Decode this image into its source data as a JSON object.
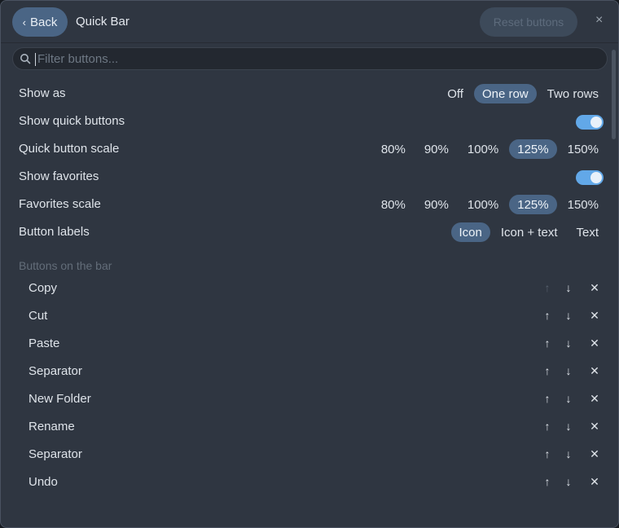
{
  "header": {
    "back_label": "Back",
    "title": "Quick Bar",
    "reset_label": "Reset buttons",
    "close_glyph": "×"
  },
  "search": {
    "placeholder": "Filter buttons..."
  },
  "settings": [
    {
      "label": "Show as",
      "type": "segmented",
      "options": [
        "Off",
        "One row",
        "Two rows"
      ],
      "selected": "One row"
    },
    {
      "label": "Show quick buttons",
      "type": "toggle",
      "value": true
    },
    {
      "label": "Quick button scale",
      "type": "segmented",
      "options": [
        "80%",
        "90%",
        "100%",
        "125%",
        "150%"
      ],
      "selected": "125%"
    },
    {
      "label": "Show favorites",
      "type": "toggle",
      "value": true
    },
    {
      "label": "Favorites scale",
      "type": "segmented",
      "options": [
        "80%",
        "90%",
        "100%",
        "125%",
        "150%"
      ],
      "selected": "125%"
    },
    {
      "label": "Button labels",
      "type": "segmented",
      "options": [
        "Icon",
        "Icon + text",
        "Text"
      ],
      "selected": "Icon"
    }
  ],
  "buttons_section": {
    "title": "Buttons on the bar",
    "items": [
      {
        "name": "Copy",
        "up_enabled": false
      },
      {
        "name": "Cut",
        "up_enabled": true
      },
      {
        "name": "Paste",
        "up_enabled": true
      },
      {
        "name": "Separator",
        "up_enabled": true
      },
      {
        "name": "New Folder",
        "up_enabled": true
      },
      {
        "name": "Rename",
        "up_enabled": true
      },
      {
        "name": "Separator",
        "up_enabled": true
      },
      {
        "name": "Undo",
        "up_enabled": true
      }
    ],
    "up_glyph": "↑",
    "down_glyph": "↓",
    "remove_glyph": "✕"
  },
  "colors": {
    "background": "#2f3641",
    "accent": "#4a6585",
    "toggle_on": "#62a8e8"
  }
}
